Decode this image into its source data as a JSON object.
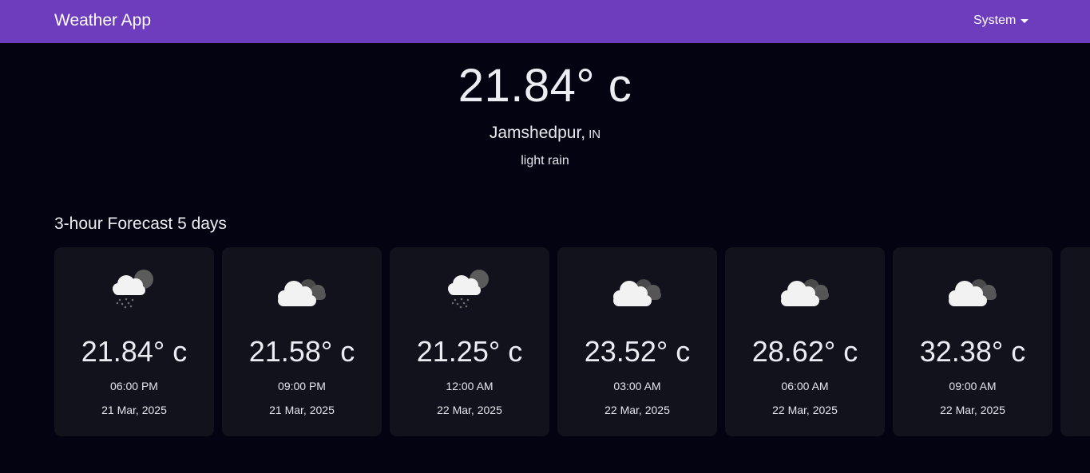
{
  "app": {
    "title": "Weather App",
    "theme_label": "System"
  },
  "current": {
    "temperature": "21.84° c",
    "city": "Jamshedpur,",
    "country": "IN",
    "description": "light rain"
  },
  "forecast": {
    "title": "3-hour Forecast 5 days",
    "items": [
      {
        "icon": "light-rain-cloud-icon",
        "temp": "21.84° c",
        "time": "06:00 PM",
        "date": "21 Mar, 2025"
      },
      {
        "icon": "broken-clouds-icon",
        "temp": "21.58° c",
        "time": "09:00 PM",
        "date": "21 Mar, 2025"
      },
      {
        "icon": "light-rain-cloud-icon",
        "temp": "21.25° c",
        "time": "12:00 AM",
        "date": "22 Mar, 2025"
      },
      {
        "icon": "broken-clouds-icon",
        "temp": "23.52° c",
        "time": "03:00 AM",
        "date": "22 Mar, 2025"
      },
      {
        "icon": "broken-clouds-icon",
        "temp": "28.62° c",
        "time": "06:00 AM",
        "date": "22 Mar, 2025"
      },
      {
        "icon": "broken-clouds-icon",
        "temp": "32.38° c",
        "time": "09:00 AM",
        "date": "22 Mar, 2025"
      },
      {
        "icon": "",
        "temp": "",
        "time": "",
        "date": ""
      }
    ]
  },
  "colors": {
    "appbar": "#6e3dbd",
    "background": "#030311",
    "card": "#11121b"
  }
}
